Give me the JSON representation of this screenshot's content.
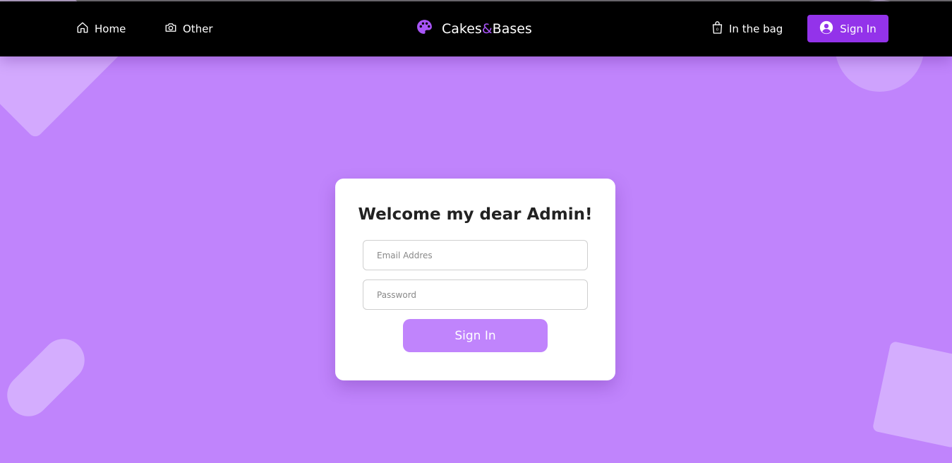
{
  "nav": {
    "home_label": "Home",
    "other_label": "Other",
    "brand_part1": "Cakes",
    "brand_amp": "&",
    "brand_part2": "Bases",
    "bag_label": "In the bag",
    "signin_label": "Sign In"
  },
  "login": {
    "title": "Welcome my dear Admin!",
    "email_placeholder": "Email Addres",
    "password_placeholder": "Password",
    "submit_label": "Sign In"
  },
  "colors": {
    "background": "#c084fc",
    "header": "#000000",
    "accent": "#9333ea"
  }
}
